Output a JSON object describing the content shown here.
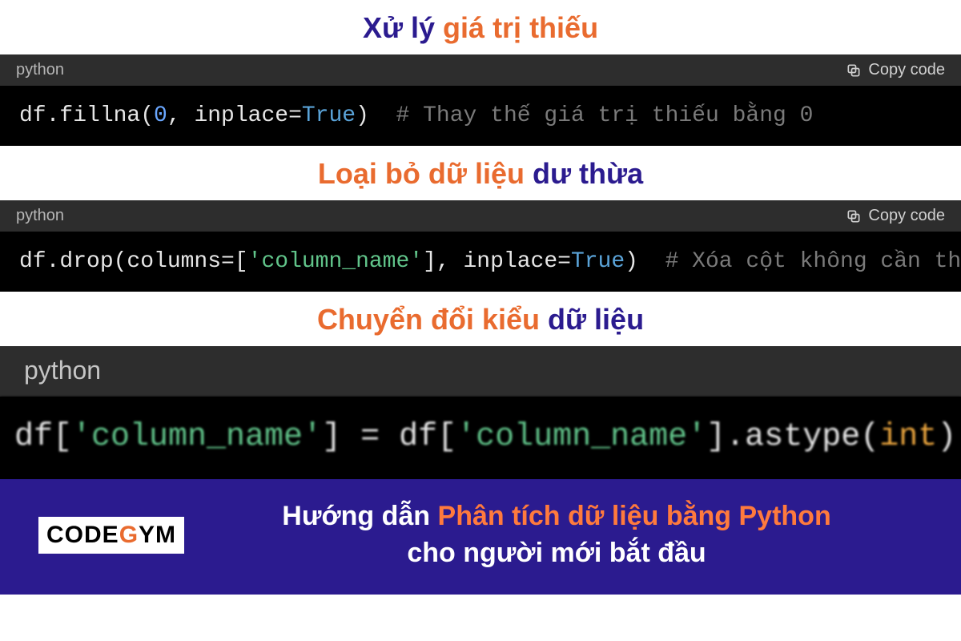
{
  "heading1": {
    "part1": "Xử lý ",
    "part2": "giá trị thiếu"
  },
  "heading2": {
    "part1": "Loại bỏ dữ liệu ",
    "part2": "dư thừa"
  },
  "heading3": {
    "part1": "Chuyển đổi kiểu ",
    "part2": "dữ liệu"
  },
  "block1": {
    "lang": "python",
    "copy": "Copy code",
    "code_plain": "df.fillna(",
    "num": "0",
    "mid1": ", inplace=",
    "true": "True",
    "close": ")  ",
    "comment": "# Thay thế giá trị thiếu bằng 0"
  },
  "block2": {
    "lang": "python",
    "copy": "Copy code",
    "code_plain": "df.drop(columns=[",
    "str": "'column_name'",
    "mid1": "], inplace=",
    "true": "True",
    "close": ")  ",
    "comment": "# Xóa cột không cần thiết"
  },
  "block3": {
    "lang": "python",
    "lhs1": "df[",
    "str1": "'column_name'",
    "mid": "] = df[",
    "str2": "'column_name'",
    "rhs1": "].astype(",
    "type": "int",
    "rhs2": ")"
  },
  "footer": {
    "logo_prefix": "CODE",
    "logo_g": "G",
    "logo_suffix": "YM",
    "line1a": "Hướng dẫn ",
    "line1b": "Phân tích dữ liệu bằng Python",
    "line2": "cho người mới bắt đầu"
  }
}
